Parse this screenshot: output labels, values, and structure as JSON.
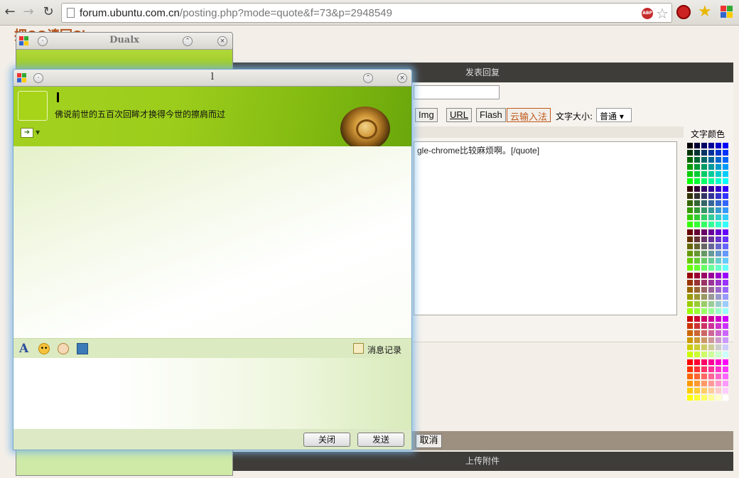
{
  "browser": {
    "url_host": "forum.ubuntu.com.cn",
    "url_rest": "/posting.php?mode=quote&f=73&p=2948549",
    "abp_label": "ABP"
  },
  "forum": {
    "page_title": "把QQ请回Chrome",
    "top_bar_label": "发表回复",
    "bbcode_buttons": [
      "Img",
      "URL",
      "Flash",
      "云输入法"
    ],
    "font_size_label": "文字大小:",
    "font_size_value": "普通",
    "textarea_text": "gle-chrome比较麻烦啊。[/quote]",
    "color_label": "文字颜色",
    "cancel_label": "取消",
    "upload_label": "上传附件"
  },
  "dualx_window": {
    "title": "Dualx"
  },
  "chat_window": {
    "title": "l",
    "signature": "佛说前世的五百次回眸才换得今世的擦肩而过",
    "history_label": "消息记录",
    "close_label": "关闭",
    "send_label": "发送"
  },
  "colors": {
    "header_green": "#9ccd1c",
    "forum_accent": "#b3531d",
    "dark_bar": "#3f3d3a"
  }
}
